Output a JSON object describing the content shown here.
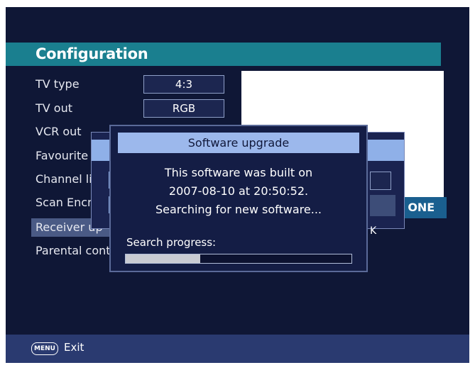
{
  "title": "Configuration",
  "menu_items": [
    "TV type",
    "TV out",
    "VCR out",
    "Favourite r",
    "Channel lis",
    "Scan Encry",
    "Receiver up",
    "Parental cont"
  ],
  "selected_index": 6,
  "values": {
    "tv_type": "4:3",
    "tv_out": "RGB"
  },
  "channel_strip": "C ONE",
  "back_dialog": {
    "mark": "K"
  },
  "dialog": {
    "title": "Software upgrade",
    "message_line1": "This software was built on",
    "message_line2": "2007-08-10 at 20:50:52.",
    "message_line3": "Searching for new software...",
    "progress_label": "Search progress:",
    "progress_value": 0.33
  },
  "footer": {
    "menu_key": "MENU",
    "exit_label": "Exit"
  },
  "colors": {
    "title_bar": "#1a7f8f",
    "background": "#0f1736",
    "dialog_header": "#9cb8ec",
    "footer": "#2a3a70"
  }
}
